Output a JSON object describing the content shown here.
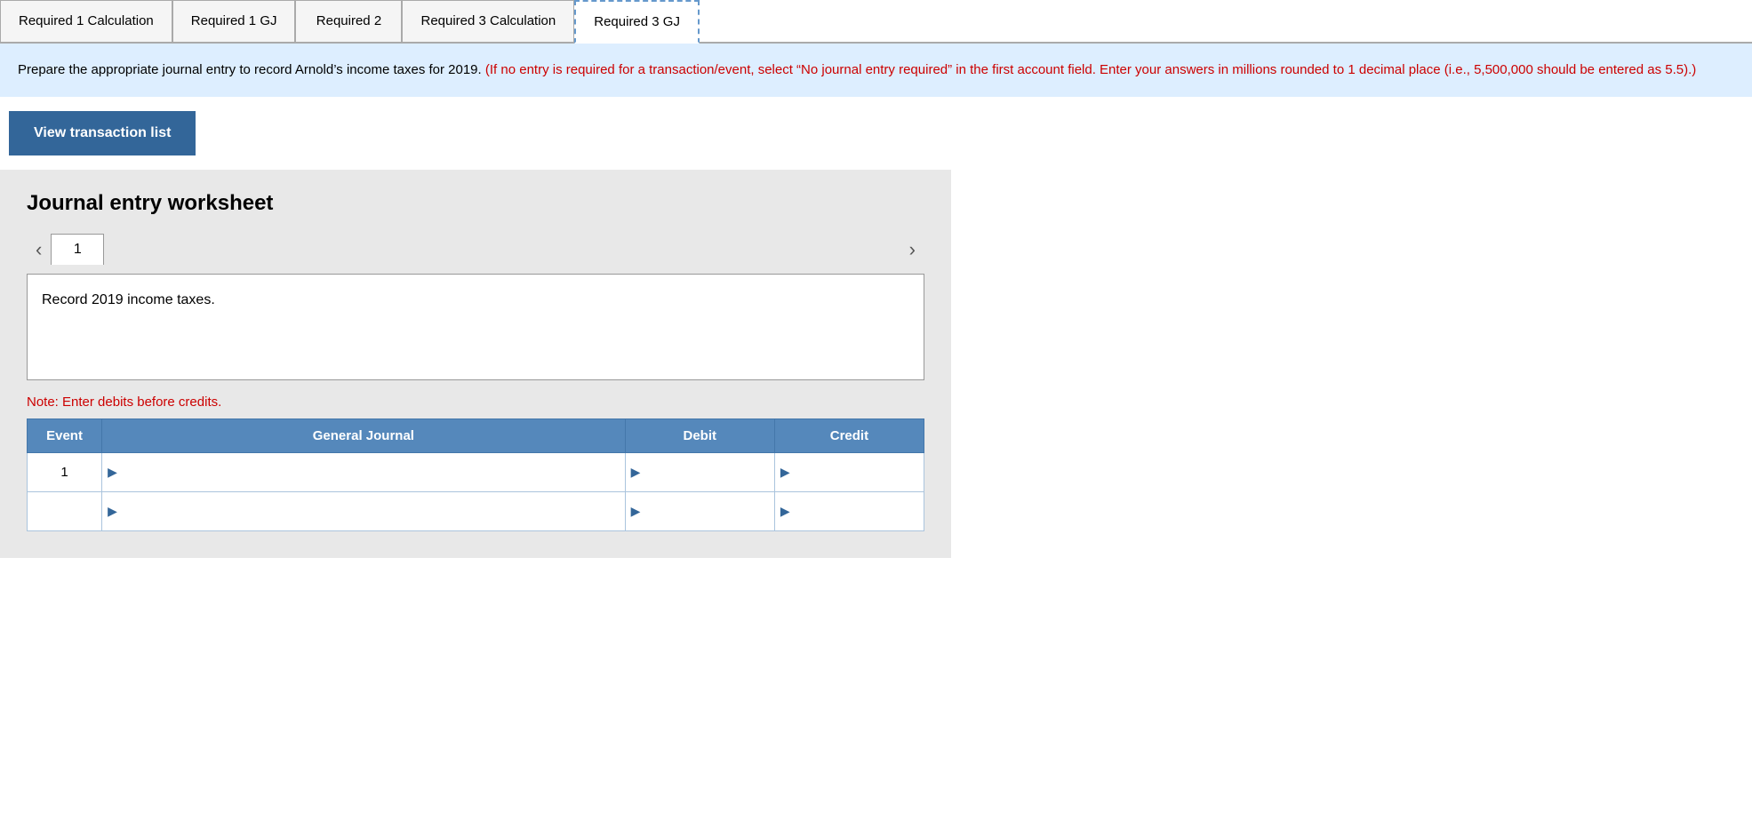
{
  "tabs": [
    {
      "id": "req1calc",
      "label": "Required 1\nCalculation",
      "active": false
    },
    {
      "id": "req1gj",
      "label": "Required 1 GJ",
      "active": false
    },
    {
      "id": "req2",
      "label": "Required 2",
      "active": false
    },
    {
      "id": "req3calc",
      "label": "Required 3\nCalculation",
      "active": false
    },
    {
      "id": "req3gj",
      "label": "Required 3 GJ",
      "active": true
    }
  ],
  "instructions": {
    "main_text": "Prepare the appropriate journal entry to record Arnold’s income taxes for 2019.",
    "red_text": "(If no entry is required for a transaction/event, select “No journal entry required” in the first account field. Enter your answers in millions rounded to 1 decimal place (i.e., 5,500,000 should be entered as 5.5).)"
  },
  "view_transaction_label": "View transaction list",
  "worksheet": {
    "title": "Journal entry worksheet",
    "current_page": "1",
    "description": "Record 2019 income taxes.",
    "note": "Note: Enter debits before credits.",
    "table": {
      "headers": [
        "Event",
        "General Journal",
        "Debit",
        "Credit"
      ],
      "rows": [
        {
          "event": "1",
          "general_journal": "",
          "debit": "",
          "credit": ""
        },
        {
          "event": "",
          "general_journal": "",
          "debit": "",
          "credit": ""
        }
      ]
    }
  }
}
